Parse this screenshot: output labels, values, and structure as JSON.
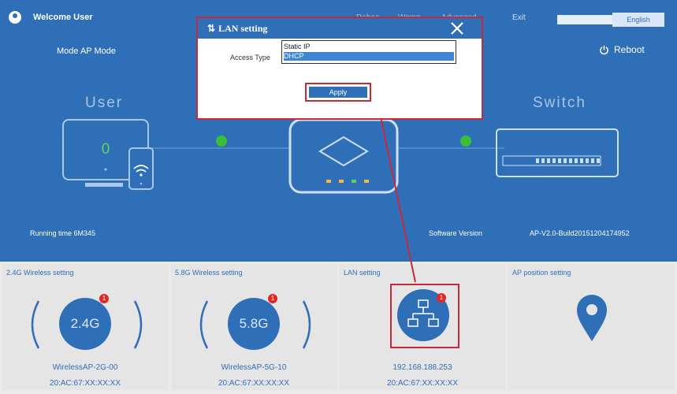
{
  "header": {
    "welcome": "Welcome User",
    "link1": "Dahaa",
    "link2": "Wamp",
    "link3": "Advanced",
    "exit": "Exit",
    "language": "English"
  },
  "status": {
    "mode": "Mode  AP Mode",
    "reboot": "Reboot",
    "user_label": "User",
    "switch_label": "Switch",
    "user_count": "0",
    "running_time": "Running time  6M345",
    "software_version_label": "Software Version",
    "software_version_value": "AP-V2.0-Build20151204174952"
  },
  "panels": [
    {
      "title": "2.4G Wireless setting",
      "icon_text": "2.4G",
      "badge": "1",
      "name": "WirelessAP-2G-00",
      "mac": "20:AC:67:XX:XX:XX"
    },
    {
      "title": "5.8G Wireless setting",
      "icon_text": "5.8G",
      "badge": "1",
      "name": "WirelessAP-5G-10",
      "mac": "20:AC:67:XX:XX:XX"
    },
    {
      "title": "LAN setting",
      "badge": "1",
      "name": "192.168.188.253",
      "mac": "20:AC:67:XX:XX:XX"
    },
    {
      "title": "AP position setting"
    }
  ],
  "dialog": {
    "title": "LAN setting",
    "access_type_label": "Access Type",
    "options": [
      "Static IP",
      "DHCP"
    ],
    "selected": "DHCP",
    "apply": "Apply"
  },
  "colors": {
    "brand_blue": "#2f6fb8",
    "highlight_red": "#c8293a",
    "status_green": "#3bbf3b",
    "badge_red": "#e32626"
  }
}
